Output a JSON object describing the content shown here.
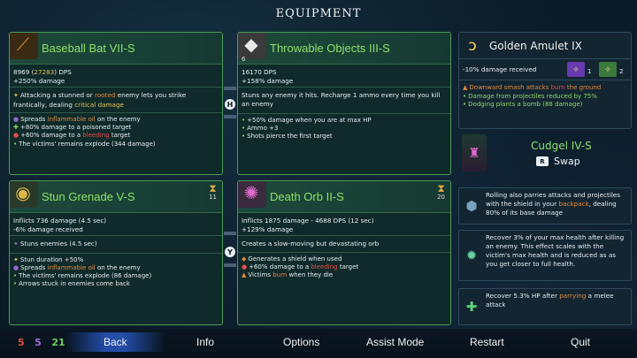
{
  "screen_title": "EQUIPMENT",
  "colors": {
    "card_border": "#4b9a58",
    "name_green": "#8fe06a",
    "orange": "#e28b3c",
    "red": "#ec4d4d",
    "yellow": "#e6c35a"
  },
  "weapons": {
    "primary": {
      "name": "Baseball Bat VII-S",
      "icon": "baseball-bat-icon",
      "dps_value": "8969",
      "dps_crit": "27283",
      "dps_suffix": " DPS",
      "bonus": "+250% damage",
      "desc_a": "Attacking a stunned or ",
      "desc_kw1": "rooted",
      "desc_b": " enemy lets you strike frantically, dealing ",
      "desc_kw2": "critical damage",
      "desc_c": "",
      "affixes": [
        {
          "pre": "Spreads ",
          "kw": "inflammable oil",
          "post": " on the enemy"
        },
        {
          "pre": "+80% damage to a poisoned target",
          "kw": "",
          "post": ""
        },
        {
          "pre": "+60% damage to a ",
          "kw": "bleeding",
          "post": " target"
        },
        {
          "pre": "The victims' remains explode (344 damage)",
          "kw": "",
          "post": ""
        }
      ]
    },
    "secondary": {
      "name": "Throwable Objects III-S",
      "icon": "throwable-objects-icon",
      "ammo": "6",
      "dps": "16170 DPS",
      "bonus": "+158% damage",
      "desc": "Stuns any enemy it hits. Recharge 1 ammo every time you kill an enemy",
      "affixes": [
        "+50% damage when you are at max HP",
        "Ammo +3",
        "Shots pierce the first target"
      ]
    }
  },
  "skills": {
    "left": {
      "name": "Stun Grenade V-S",
      "icon": "stun-grenade-icon",
      "cooldown": "11",
      "line1": "Inflicts 736 damage (4.5 sec)",
      "line2": "-6% damage received",
      "desc": "Stuns enemies (4.5 sec)",
      "affixes": [
        {
          "pre": "Stun duration +50%",
          "kw": "",
          "post": ""
        },
        {
          "pre": "Spreads ",
          "kw": "inflammable oil",
          "post": " on the enemy"
        },
        {
          "pre": "The victims' remains explode (86 damage)",
          "kw": "",
          "post": ""
        },
        {
          "pre": "Arrows stuck in enemies come back",
          "kw": "",
          "post": ""
        }
      ]
    },
    "right": {
      "name": "Death Orb II-S",
      "icon": "death-orb-icon",
      "cooldown": "20",
      "line1": "Inflicts 1875 damage - 4688 DPS (12 sec)",
      "line2": "+129% damage",
      "desc": "Creates a slow-moving but devastating orb",
      "affixes": [
        {
          "pre": "Generates a shield when used",
          "kw": "",
          "post": ""
        },
        {
          "pre": "+60% damage to a ",
          "kw": "bleeding",
          "post": " target"
        },
        {
          "pre": "Victims ",
          "kw": "burn",
          "post": " when they die"
        }
      ]
    }
  },
  "swap_keys": {
    "weapons": "H",
    "skills": "Y"
  },
  "amulet": {
    "name": "Golden Amulet IX",
    "icon": "amulet-icon",
    "stat": "-10% damage received",
    "scroll1_count": "1",
    "scroll2_count": "2",
    "line_a_pre": "Downward smash attacks ",
    "line_a_kw": "burn",
    "line_a_post": " the ground",
    "line_b": "Damage from projectiles reduced by 75%",
    "line_c": "Dodging plants a bomb (88 damage)"
  },
  "backpack": {
    "name": "Cudgel IV-S",
    "icon": "cudgel-icon",
    "swap_key": "R",
    "swap_label": "Swap"
  },
  "mutations": [
    {
      "icon": "shield-mutation-icon",
      "pre": "Rolling also parries attacks and projectiles with the shield in your ",
      "kw": "backpack",
      "post": ", dealing 80% of its base damage"
    },
    {
      "icon": "predator-mutation-icon",
      "pre": "Recover 3% of your max health after killing an enemy. This effect scales with the victim's max health and is reduced as as you get closer to full health.",
      "kw": "",
      "post": ""
    },
    {
      "icon": "heal-mutation-icon",
      "pre": "Recover 5.3% HP after ",
      "kw": "parrying",
      "post": " a melee attack"
    }
  ],
  "scrolls": {
    "brutality": "5",
    "tactics": "5",
    "survival": "21"
  },
  "menu": [
    "Back",
    "Info",
    "Options",
    "Assist Mode",
    "Restart",
    "Quit"
  ]
}
